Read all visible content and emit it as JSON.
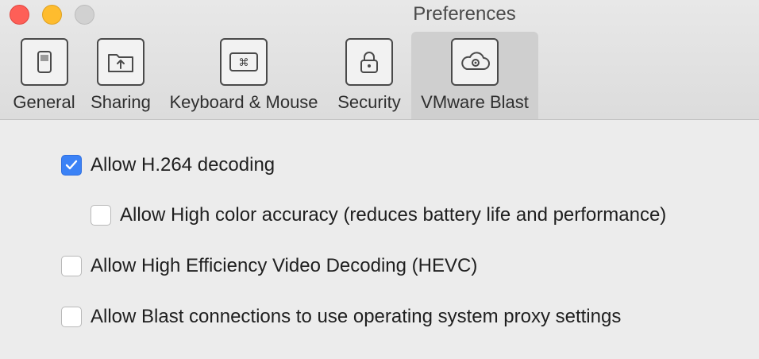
{
  "window": {
    "title": "Preferences"
  },
  "tabs": [
    {
      "label": "General",
      "icon": "general-icon",
      "active": false
    },
    {
      "label": "Sharing",
      "icon": "folder-share-icon",
      "active": false
    },
    {
      "label": "Keyboard & Mouse",
      "icon": "keyboard-icon",
      "active": false
    },
    {
      "label": "Security",
      "icon": "lock-icon",
      "active": false
    },
    {
      "label": "VMware Blast",
      "icon": "cloud-gear-icon",
      "active": true
    }
  ],
  "options": [
    {
      "label": "Allow H.264 decoding",
      "checked": true
    },
    {
      "label": "Allow High color accuracy (reduces battery life and performance)",
      "checked": false
    },
    {
      "label": "Allow High Efficiency Video Decoding (HEVC)",
      "checked": false
    },
    {
      "label": "Allow Blast connections to use operating system proxy settings",
      "checked": false
    }
  ],
  "colors": {
    "accent": "#3b82f6",
    "close": "#fe5f57",
    "minimize": "#febc2e",
    "maximize": "#d1d1d1"
  }
}
